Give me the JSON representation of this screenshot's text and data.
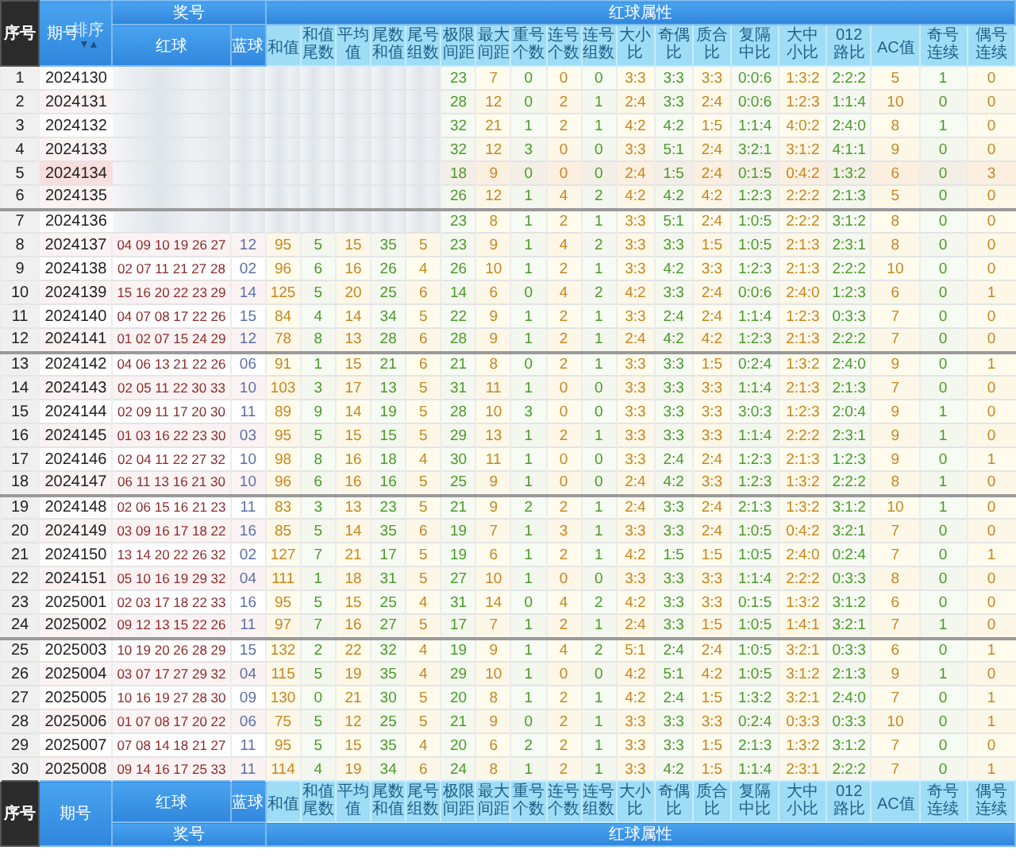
{
  "header": {
    "index": "序号",
    "issue": "期号",
    "sort": "排序",
    "prize": "奖号",
    "red": "红球",
    "blue": "蓝球",
    "attrs_title": "红球属性",
    "attrs": [
      "和值",
      "和值尾数",
      "平均值",
      "尾数和值",
      "尾号组数",
      "极限间距",
      "最大间距",
      "重号个数",
      "连号个数",
      "连号组数",
      "大小比",
      "奇偶比",
      "质合比",
      "复隔中比",
      "大中小比",
      "012路比",
      "AC值",
      "奇号连续",
      "偶号连续"
    ]
  },
  "groups": [
    {
      "rows": [
        {
          "no": "1",
          "issue": "2024130",
          "highlighted": false,
          "span": "23",
          "max_gap": "7",
          "repeats": "0",
          "consec_count": "0",
          "consec_groups": "0",
          "big_small": "3:3",
          "odd_even": "3:3",
          "prime_composite": "3:3",
          "repeat_gap_mid": "0:0:6",
          "big_mid_small": "1:3:2",
          "route_012": "2:2:2",
          "ac": "5",
          "odd_run": "1",
          "even_run": "0"
        },
        {
          "no": "2",
          "issue": "2024131",
          "highlighted": false,
          "span": "28",
          "max_gap": "12",
          "repeats": "0",
          "consec_count": "2",
          "consec_groups": "1",
          "big_small": "2:4",
          "odd_even": "3:3",
          "prime_composite": "2:4",
          "repeat_gap_mid": "0:0:6",
          "big_mid_small": "1:2:3",
          "route_012": "1:1:4",
          "ac": "10",
          "odd_run": "0",
          "even_run": "0"
        },
        {
          "no": "3",
          "issue": "2024132",
          "highlighted": false,
          "span": "32",
          "max_gap": "21",
          "repeats": "1",
          "consec_count": "2",
          "consec_groups": "1",
          "big_small": "4:2",
          "odd_even": "4:2",
          "prime_composite": "1:5",
          "repeat_gap_mid": "1:1:4",
          "big_mid_small": "4:0:2",
          "route_012": "2:4:0",
          "ac": "8",
          "odd_run": "1",
          "even_run": "0"
        },
        {
          "no": "4",
          "issue": "2024133",
          "highlighted": false,
          "span": "32",
          "max_gap": "12",
          "repeats": "3",
          "consec_count": "0",
          "consec_groups": "0",
          "big_small": "3:3",
          "odd_even": "5:1",
          "prime_composite": "2:4",
          "repeat_gap_mid": "3:2:1",
          "big_mid_small": "3:1:2",
          "route_012": "4:1:1",
          "ac": "9",
          "odd_run": "0",
          "even_run": "0"
        },
        {
          "no": "5",
          "issue": "2024134",
          "highlighted": true,
          "span": "18",
          "max_gap": "9",
          "repeats": "0",
          "consec_count": "0",
          "consec_groups": "0",
          "big_small": "2:4",
          "odd_even": "1:5",
          "prime_composite": "2:4",
          "repeat_gap_mid": "0:1:5",
          "big_mid_small": "0:4:2",
          "route_012": "1:3:2",
          "ac": "6",
          "odd_run": "0",
          "even_run": "3"
        },
        {
          "no": "6",
          "issue": "2024135",
          "highlighted": false,
          "span": "26",
          "max_gap": "12",
          "repeats": "1",
          "consec_count": "4",
          "consec_groups": "2",
          "big_small": "4:2",
          "odd_even": "4:2",
          "prime_composite": "4:2",
          "repeat_gap_mid": "1:2:3",
          "big_mid_small": "2:2:2",
          "route_012": "2:1:3",
          "ac": "5",
          "odd_run": "0",
          "even_run": "0"
        }
      ]
    },
    {
      "rows": [
        {
          "no": "7",
          "issue": "2024136",
          "highlighted": false,
          "span": "23",
          "max_gap": "8",
          "repeats": "1",
          "consec_count": "2",
          "consec_groups": "1",
          "big_small": "3:3",
          "odd_even": "5:1",
          "prime_composite": "2:4",
          "repeat_gap_mid": "1:0:5",
          "big_mid_small": "2:2:2",
          "route_012": "3:1:2",
          "ac": "8",
          "odd_run": "0",
          "even_run": "0"
        },
        {
          "no": "8",
          "issue": "2024137",
          "red": "04 09 10 19 26 27",
          "blue": "12",
          "highlighted": false,
          "sum": "95",
          "sum_tail": "5",
          "average": "15",
          "tail_sum": "35",
          "tail_groups": "5",
          "span": "23",
          "max_gap": "9",
          "repeats": "1",
          "consec_count": "4",
          "consec_groups": "2",
          "big_small": "3:3",
          "odd_even": "3:3",
          "prime_composite": "1:5",
          "repeat_gap_mid": "1:0:5",
          "big_mid_small": "2:1:3",
          "route_012": "2:3:1",
          "ac": "8",
          "odd_run": "0",
          "even_run": "0"
        },
        {
          "no": "9",
          "issue": "2024138",
          "red": "02 07 11 21 27 28",
          "blue": "02",
          "highlighted": false,
          "sum": "96",
          "sum_tail": "6",
          "average": "16",
          "tail_sum": "26",
          "tail_groups": "4",
          "span": "26",
          "max_gap": "10",
          "repeats": "1",
          "consec_count": "2",
          "consec_groups": "1",
          "big_small": "3:3",
          "odd_even": "4:2",
          "prime_composite": "3:3",
          "repeat_gap_mid": "1:2:3",
          "big_mid_small": "2:1:3",
          "route_012": "2:2:2",
          "ac": "10",
          "odd_run": "0",
          "even_run": "0"
        },
        {
          "no": "10",
          "issue": "2024139",
          "red": "15 16 20 22 23 29",
          "blue": "14",
          "highlighted": false,
          "sum": "125",
          "sum_tail": "5",
          "average": "20",
          "tail_sum": "25",
          "tail_groups": "6",
          "span": "14",
          "max_gap": "6",
          "repeats": "0",
          "consec_count": "4",
          "consec_groups": "2",
          "big_small": "4:2",
          "odd_even": "3:3",
          "prime_composite": "2:4",
          "repeat_gap_mid": "0:0:6",
          "big_mid_small": "2:4:0",
          "route_012": "1:2:3",
          "ac": "6",
          "odd_run": "0",
          "even_run": "1"
        },
        {
          "no": "11",
          "issue": "2024140",
          "red": "04 07 08 17 22 26",
          "blue": "15",
          "highlighted": false,
          "sum": "84",
          "sum_tail": "4",
          "average": "14",
          "tail_sum": "34",
          "tail_groups": "5",
          "span": "22",
          "max_gap": "9",
          "repeats": "1",
          "consec_count": "2",
          "consec_groups": "1",
          "big_small": "3:3",
          "odd_even": "2:4",
          "prime_composite": "2:4",
          "repeat_gap_mid": "1:1:4",
          "big_mid_small": "1:2:3",
          "route_012": "0:3:3",
          "ac": "7",
          "odd_run": "0",
          "even_run": "0"
        },
        {
          "no": "12",
          "issue": "2024141",
          "red": "01 02 07 15 24 29",
          "blue": "12",
          "highlighted": false,
          "sum": "78",
          "sum_tail": "8",
          "average": "13",
          "tail_sum": "28",
          "tail_groups": "6",
          "span": "28",
          "max_gap": "9",
          "repeats": "1",
          "consec_count": "2",
          "consec_groups": "1",
          "big_small": "2:4",
          "odd_even": "4:2",
          "prime_composite": "4:2",
          "repeat_gap_mid": "1:2:3",
          "big_mid_small": "2:1:3",
          "route_012": "2:2:2",
          "ac": "7",
          "odd_run": "0",
          "even_run": "0"
        }
      ]
    },
    {
      "rows": [
        {
          "no": "13",
          "issue": "2024142",
          "red": "04 06 13 21 22 26",
          "blue": "06",
          "highlighted": false,
          "sum": "91",
          "sum_tail": "1",
          "average": "15",
          "tail_sum": "21",
          "tail_groups": "6",
          "span": "21",
          "max_gap": "8",
          "repeats": "0",
          "consec_count": "2",
          "consec_groups": "1",
          "big_small": "3:3",
          "odd_even": "3:3",
          "prime_composite": "1:5",
          "repeat_gap_mid": "0:2:4",
          "big_mid_small": "1:3:2",
          "route_012": "2:4:0",
          "ac": "9",
          "odd_run": "0",
          "even_run": "1"
        },
        {
          "no": "14",
          "issue": "2024143",
          "red": "02 05 11 22 30 33",
          "blue": "10",
          "highlighted": false,
          "sum": "103",
          "sum_tail": "3",
          "average": "17",
          "tail_sum": "13",
          "tail_groups": "5",
          "span": "31",
          "max_gap": "11",
          "repeats": "1",
          "consec_count": "0",
          "consec_groups": "0",
          "big_small": "3:3",
          "odd_even": "3:3",
          "prime_composite": "3:3",
          "repeat_gap_mid": "1:1:4",
          "big_mid_small": "2:1:3",
          "route_012": "2:1:3",
          "ac": "7",
          "odd_run": "0",
          "even_run": "0"
        },
        {
          "no": "15",
          "issue": "2024144",
          "red": "02 09 11 17 20 30",
          "blue": "11",
          "highlighted": false,
          "sum": "89",
          "sum_tail": "9",
          "average": "14",
          "tail_sum": "19",
          "tail_groups": "5",
          "span": "28",
          "max_gap": "10",
          "repeats": "3",
          "consec_count": "0",
          "consec_groups": "0",
          "big_small": "3:3",
          "odd_even": "3:3",
          "prime_composite": "3:3",
          "repeat_gap_mid": "3:0:3",
          "big_mid_small": "1:2:3",
          "route_012": "2:0:4",
          "ac": "9",
          "odd_run": "1",
          "even_run": "0"
        },
        {
          "no": "16",
          "issue": "2024145",
          "red": "01 03 16 22 23 30",
          "blue": "03",
          "highlighted": false,
          "sum": "95",
          "sum_tail": "5",
          "average": "15",
          "tail_sum": "15",
          "tail_groups": "5",
          "span": "29",
          "max_gap": "13",
          "repeats": "1",
          "consec_count": "2",
          "consec_groups": "1",
          "big_small": "3:3",
          "odd_even": "3:3",
          "prime_composite": "3:3",
          "repeat_gap_mid": "1:1:4",
          "big_mid_small": "2:2:2",
          "route_012": "2:3:1",
          "ac": "9",
          "odd_run": "1",
          "even_run": "0"
        },
        {
          "no": "17",
          "issue": "2024146",
          "red": "02 04 11 22 27 32",
          "blue": "10",
          "highlighted": false,
          "sum": "98",
          "sum_tail": "8",
          "average": "16",
          "tail_sum": "18",
          "tail_groups": "4",
          "span": "30",
          "max_gap": "11",
          "repeats": "1",
          "consec_count": "0",
          "consec_groups": "0",
          "big_small": "3:3",
          "odd_even": "2:4",
          "prime_composite": "2:4",
          "repeat_gap_mid": "1:2:3",
          "big_mid_small": "2:1:3",
          "route_012": "1:2:3",
          "ac": "9",
          "odd_run": "0",
          "even_run": "1"
        },
        {
          "no": "18",
          "issue": "2024147",
          "red": "06 11 13 16 21 30",
          "blue": "10",
          "highlighted": false,
          "sum": "96",
          "sum_tail": "6",
          "average": "16",
          "tail_sum": "16",
          "tail_groups": "5",
          "span": "25",
          "max_gap": "9",
          "repeats": "1",
          "consec_count": "0",
          "consec_groups": "0",
          "big_small": "2:4",
          "odd_even": "4:2",
          "prime_composite": "3:3",
          "repeat_gap_mid": "1:2:3",
          "big_mid_small": "1:3:2",
          "route_012": "2:2:2",
          "ac": "8",
          "odd_run": "1",
          "even_run": "0"
        }
      ]
    },
    {
      "rows": [
        {
          "no": "19",
          "issue": "2024148",
          "red": "02 06 15 16 21 23",
          "blue": "11",
          "highlighted": false,
          "sum": "83",
          "sum_tail": "3",
          "average": "13",
          "tail_sum": "23",
          "tail_groups": "5",
          "span": "21",
          "max_gap": "9",
          "repeats": "2",
          "consec_count": "2",
          "consec_groups": "1",
          "big_small": "2:4",
          "odd_even": "3:3",
          "prime_composite": "2:4",
          "repeat_gap_mid": "2:1:3",
          "big_mid_small": "1:3:2",
          "route_012": "3:1:2",
          "ac": "10",
          "odd_run": "1",
          "even_run": "0"
        },
        {
          "no": "20",
          "issue": "2024149",
          "red": "03 09 16 17 18 22",
          "blue": "16",
          "highlighted": false,
          "sum": "85",
          "sum_tail": "5",
          "average": "14",
          "tail_sum": "35",
          "tail_groups": "6",
          "span": "19",
          "max_gap": "7",
          "repeats": "1",
          "consec_count": "3",
          "consec_groups": "1",
          "big_small": "3:3",
          "odd_even": "3:3",
          "prime_composite": "2:4",
          "repeat_gap_mid": "1:0:5",
          "big_mid_small": "0:4:2",
          "route_012": "3:2:1",
          "ac": "7",
          "odd_run": "0",
          "even_run": "0"
        },
        {
          "no": "21",
          "issue": "2024150",
          "red": "13 14 20 22 26 32",
          "blue": "02",
          "highlighted": false,
          "sum": "127",
          "sum_tail": "7",
          "average": "21",
          "tail_sum": "17",
          "tail_groups": "5",
          "span": "19",
          "max_gap": "6",
          "repeats": "1",
          "consec_count": "2",
          "consec_groups": "1",
          "big_small": "4:2",
          "odd_even": "1:5",
          "prime_composite": "1:5",
          "repeat_gap_mid": "1:0:5",
          "big_mid_small": "2:4:0",
          "route_012": "0:2:4",
          "ac": "7",
          "odd_run": "0",
          "even_run": "1"
        },
        {
          "no": "22",
          "issue": "2024151",
          "red": "05 10 16 19 29 32",
          "blue": "04",
          "highlighted": false,
          "sum": "111",
          "sum_tail": "1",
          "average": "18",
          "tail_sum": "31",
          "tail_groups": "5",
          "span": "27",
          "max_gap": "10",
          "repeats": "1",
          "consec_count": "0",
          "consec_groups": "0",
          "big_small": "3:3",
          "odd_even": "3:3",
          "prime_composite": "3:3",
          "repeat_gap_mid": "1:1:4",
          "big_mid_small": "2:2:2",
          "route_012": "0:3:3",
          "ac": "8",
          "odd_run": "0",
          "even_run": "0"
        },
        {
          "no": "23",
          "issue": "2025001",
          "red": "02 03 17 18 22 33",
          "blue": "16",
          "highlighted": false,
          "sum": "95",
          "sum_tail": "5",
          "average": "15",
          "tail_sum": "25",
          "tail_groups": "4",
          "span": "31",
          "max_gap": "14",
          "repeats": "0",
          "consec_count": "4",
          "consec_groups": "2",
          "big_small": "4:2",
          "odd_even": "3:3",
          "prime_composite": "3:3",
          "repeat_gap_mid": "0:1:5",
          "big_mid_small": "1:3:2",
          "route_012": "3:1:2",
          "ac": "6",
          "odd_run": "0",
          "even_run": "0"
        },
        {
          "no": "24",
          "issue": "2025002",
          "red": "09 12 13 15 22 26",
          "blue": "11",
          "highlighted": false,
          "sum": "97",
          "sum_tail": "7",
          "average": "16",
          "tail_sum": "27",
          "tail_groups": "5",
          "span": "17",
          "max_gap": "7",
          "repeats": "1",
          "consec_count": "2",
          "consec_groups": "1",
          "big_small": "2:4",
          "odd_even": "3:3",
          "prime_composite": "1:5",
          "repeat_gap_mid": "1:0:5",
          "big_mid_small": "1:4:1",
          "route_012": "3:2:1",
          "ac": "7",
          "odd_run": "1",
          "even_run": "0"
        }
      ]
    },
    {
      "rows": [
        {
          "no": "25",
          "issue": "2025003",
          "red": "10 19 20 26 28 29",
          "blue": "15",
          "highlighted": false,
          "sum": "132",
          "sum_tail": "2",
          "average": "22",
          "tail_sum": "32",
          "tail_groups": "4",
          "span": "19",
          "max_gap": "9",
          "repeats": "1",
          "consec_count": "4",
          "consec_groups": "2",
          "big_small": "5:1",
          "odd_even": "2:4",
          "prime_composite": "2:4",
          "repeat_gap_mid": "1:0:5",
          "big_mid_small": "3:2:1",
          "route_012": "0:3:3",
          "ac": "6",
          "odd_run": "0",
          "even_run": "1"
        },
        {
          "no": "26",
          "issue": "2025004",
          "red": "03 07 17 27 29 32",
          "blue": "04",
          "highlighted": false,
          "sum": "115",
          "sum_tail": "5",
          "average": "19",
          "tail_sum": "35",
          "tail_groups": "4",
          "span": "29",
          "max_gap": "10",
          "repeats": "1",
          "consec_count": "0",
          "consec_groups": "0",
          "big_small": "4:2",
          "odd_even": "5:1",
          "prime_composite": "4:2",
          "repeat_gap_mid": "1:0:5",
          "big_mid_small": "3:1:2",
          "route_012": "2:1:3",
          "ac": "9",
          "odd_run": "1",
          "even_run": "0"
        },
        {
          "no": "27",
          "issue": "2025005",
          "red": "10 16 19 27 28 30",
          "blue": "09",
          "highlighted": false,
          "sum": "130",
          "sum_tail": "0",
          "average": "21",
          "tail_sum": "30",
          "tail_groups": "5",
          "span": "20",
          "max_gap": "8",
          "repeats": "1",
          "consec_count": "2",
          "consec_groups": "1",
          "big_small": "4:2",
          "odd_even": "2:4",
          "prime_composite": "1:5",
          "repeat_gap_mid": "1:3:2",
          "big_mid_small": "3:2:1",
          "route_012": "2:4:0",
          "ac": "7",
          "odd_run": "0",
          "even_run": "1"
        },
        {
          "no": "28",
          "issue": "2025006",
          "red": "01 07 08 17 20 22",
          "blue": "06",
          "highlighted": false,
          "sum": "75",
          "sum_tail": "5",
          "average": "12",
          "tail_sum": "25",
          "tail_groups": "5",
          "span": "21",
          "max_gap": "9",
          "repeats": "0",
          "consec_count": "2",
          "consec_groups": "1",
          "big_small": "3:3",
          "odd_even": "3:3",
          "prime_composite": "3:3",
          "repeat_gap_mid": "0:2:4",
          "big_mid_small": "0:3:3",
          "route_012": "0:3:3",
          "ac": "10",
          "odd_run": "0",
          "even_run": "1"
        },
        {
          "no": "29",
          "issue": "2025007",
          "red": "07 08 14 18 21 27",
          "blue": "11",
          "highlighted": false,
          "sum": "95",
          "sum_tail": "5",
          "average": "15",
          "tail_sum": "35",
          "tail_groups": "4",
          "span": "20",
          "max_gap": "6",
          "repeats": "2",
          "consec_count": "2",
          "consec_groups": "1",
          "big_small": "3:3",
          "odd_even": "3:3",
          "prime_composite": "1:5",
          "repeat_gap_mid": "2:1:3",
          "big_mid_small": "1:3:2",
          "route_012": "3:1:2",
          "ac": "7",
          "odd_run": "0",
          "even_run": "0"
        },
        {
          "no": "30",
          "issue": "2025008",
          "red": "09 14 16 17 25 33",
          "blue": "11",
          "highlighted": false,
          "sum": "114",
          "sum_tail": "4",
          "average": "19",
          "tail_sum": "34",
          "tail_groups": "6",
          "span": "24",
          "max_gap": "8",
          "repeats": "1",
          "consec_count": "2",
          "consec_groups": "1",
          "big_small": "3:3",
          "odd_even": "4:2",
          "prime_composite": "1:5",
          "repeat_gap_mid": "1:1:4",
          "big_mid_small": "2:3:1",
          "route_012": "2:2:2",
          "ac": "7",
          "odd_run": "0",
          "even_run": "1"
        }
      ]
    }
  ],
  "footer": {
    "index": "序号",
    "issue": "期号",
    "red": "红球",
    "blue": "蓝球",
    "prize": "奖号",
    "attrs_title": "红球属性",
    "attrs": [
      "和值",
      "和值尾数",
      "平均值",
      "尾数和值",
      "尾号组数",
      "极限间距",
      "最大间距",
      "重号个数",
      "连号个数",
      "连号组数",
      "大小比",
      "奇偶比",
      "质合比",
      "复隔中比",
      "大中小比",
      "012路比",
      "AC值",
      "奇号连续",
      "偶号连续"
    ]
  }
}
